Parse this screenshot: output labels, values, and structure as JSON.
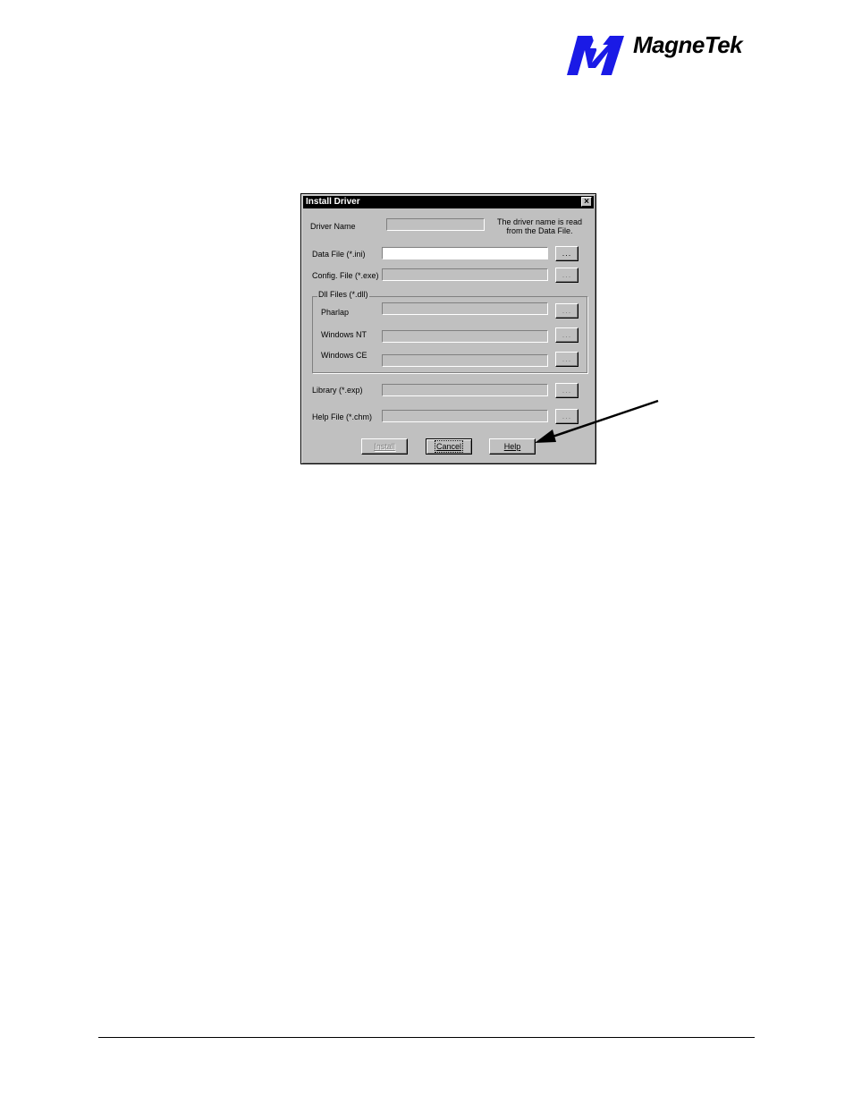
{
  "header": {
    "logo_text": "MagneTek"
  },
  "dialog": {
    "title": "Install Driver",
    "close_glyph": "×",
    "driver_name_label": "Driver Name",
    "driver_name_note_line1": "The driver name is read",
    "driver_name_note_line2": "from the Data File.",
    "data_file_label": "Data File (*.ini)",
    "config_file_label": "Config. File (*.exe)",
    "dll_group_label": "Dll Files (*.dll)",
    "pharlap_label": "Pharlap",
    "windows_nt_label": "Windows NT",
    "windows_ce_label": "Windows CE",
    "library_label": "Library (*.exp)",
    "help_file_label": "Help File (*.chm)",
    "browse_label": "...",
    "install_button": "Install",
    "cancel_button": "Cancel",
    "help_button": "Help"
  },
  "colors": {
    "dialog_face": "#c0c0c0",
    "titlebar": "#000000",
    "brand_logo": "#1a1ae6"
  }
}
